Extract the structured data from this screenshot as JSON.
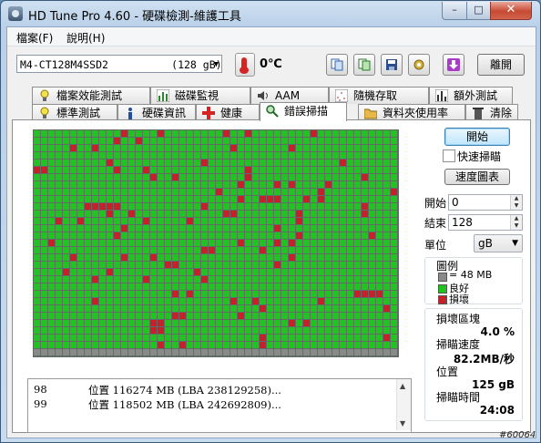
{
  "window": {
    "title": "HD Tune Pro 4.60 - 硬碟檢測-維護工具",
    "min": "–",
    "max": "□",
    "close": "✕"
  },
  "menu": {
    "file": "檔案(F)",
    "help": "說明(H)"
  },
  "toolbar": {
    "drive": "M4-CT128M4SSD2          (128 gB)",
    "temperature": "0℃",
    "exit_label": "離開"
  },
  "tabs_top": [
    {
      "label": "檔案效能測試",
      "icon": "file-benchmark-icon"
    },
    {
      "label": "磁碟監視",
      "icon": "disk-monitor-icon"
    },
    {
      "label": "AAM",
      "icon": "speaker-icon"
    },
    {
      "label": "隨機存取",
      "icon": "random-access-icon"
    },
    {
      "label": "額外測試",
      "icon": "extra-tests-icon"
    }
  ],
  "tabs_bottom": [
    {
      "label": "標準測試",
      "icon": "benchmark-bulb-icon"
    },
    {
      "label": "硬碟資訊",
      "icon": "info-icon"
    },
    {
      "label": "健康",
      "icon": "health-cross-icon"
    },
    {
      "label": "錯誤掃描",
      "icon": "magnifier-icon",
      "active": true
    },
    {
      "label": "資料夾使用率",
      "icon": "folder-icon"
    },
    {
      "label": "清除",
      "icon": "trash-icon"
    }
  ],
  "scan": {
    "start_button": "開始",
    "quick_scan_label": "快速掃瞄",
    "quick_scan_checked": false,
    "speed_map_button": "速度圖表",
    "start_label": "開始",
    "start_value": "0",
    "end_label": "結束",
    "end_value": "128",
    "unit_label": "單位",
    "unit_value": "gB",
    "legend_title": "圖例",
    "legend": [
      {
        "label": "= 48 MB",
        "color": "#8a8a8a"
      },
      {
        "label": "良好",
        "color": "#1fc41f"
      },
      {
        "label": "損壞",
        "color": "#c8202a"
      }
    ],
    "damaged_blocks_label": "損壞區塊",
    "damaged_blocks_value": "4.0 %",
    "scan_speed_label": "掃瞄速度",
    "scan_speed_value": "82.2MB/秒",
    "position_label": "位置",
    "position_value": "125 gB",
    "elapsed_label": "掃瞄時間",
    "elapsed_value": "24:08"
  },
  "map": {
    "cols": 50,
    "rows": 31,
    "good_color": "#1fc41f",
    "bad_color": "#c8202a",
    "unscanned_color": "#8a8a8a",
    "bad_blocks": [
      [
        0,
        12
      ],
      [
        0,
        17
      ],
      [
        0,
        26
      ],
      [
        0,
        29
      ],
      [
        0,
        38
      ],
      [
        1,
        11
      ],
      [
        1,
        14
      ],
      [
        2,
        5
      ],
      [
        2,
        8
      ],
      [
        2,
        27
      ],
      [
        2,
        35
      ],
      [
        4,
        10
      ],
      [
        4,
        23
      ],
      [
        4,
        42
      ],
      [
        5,
        0
      ],
      [
        5,
        1
      ],
      [
        5,
        11
      ],
      [
        5,
        15
      ],
      [
        5,
        29
      ],
      [
        6,
        16
      ],
      [
        6,
        19
      ],
      [
        6,
        29
      ],
      [
        6,
        45
      ],
      [
        7,
        28
      ],
      [
        7,
        33
      ],
      [
        7,
        35
      ],
      [
        7,
        40
      ],
      [
        8,
        25
      ],
      [
        8,
        39
      ],
      [
        8,
        49
      ],
      [
        9,
        28
      ],
      [
        9,
        31
      ],
      [
        9,
        32
      ],
      [
        9,
        33
      ],
      [
        9,
        37
      ],
      [
        9,
        39
      ],
      [
        10,
        7
      ],
      [
        10,
        8
      ],
      [
        10,
        9
      ],
      [
        10,
        10
      ],
      [
        10,
        11
      ],
      [
        10,
        23
      ],
      [
        10,
        45
      ],
      [
        11,
        10
      ],
      [
        11,
        13
      ],
      [
        11,
        26
      ],
      [
        11,
        27
      ],
      [
        11,
        36
      ],
      [
        11,
        45
      ],
      [
        12,
        3
      ],
      [
        12,
        6
      ],
      [
        12,
        15
      ],
      [
        12,
        21
      ],
      [
        12,
        36
      ],
      [
        13,
        12
      ],
      [
        13,
        33
      ],
      [
        14,
        11
      ],
      [
        14,
        36
      ],
      [
        14,
        46
      ],
      [
        15,
        2
      ],
      [
        15,
        28
      ],
      [
        15,
        33
      ],
      [
        15,
        35
      ],
      [
        16,
        23
      ],
      [
        16,
        24
      ],
      [
        16,
        31
      ],
      [
        17,
        5
      ],
      [
        17,
        12
      ],
      [
        17,
        16
      ],
      [
        17,
        35
      ],
      [
        18,
        18
      ],
      [
        18,
        19
      ],
      [
        18,
        33
      ],
      [
        19,
        4
      ],
      [
        19,
        10
      ],
      [
        19,
        22
      ],
      [
        20,
        8
      ],
      [
        20,
        15
      ],
      [
        20,
        23
      ],
      [
        22,
        19
      ],
      [
        22,
        21
      ],
      [
        22,
        44
      ],
      [
        22,
        45
      ],
      [
        22,
        46
      ],
      [
        22,
        47
      ],
      [
        23,
        8
      ],
      [
        23,
        27
      ],
      [
        23,
        30
      ],
      [
        23,
        39
      ],
      [
        24,
        31
      ],
      [
        24,
        48
      ],
      [
        25,
        19
      ],
      [
        25,
        20
      ],
      [
        25,
        28
      ],
      [
        26,
        16
      ],
      [
        26,
        17
      ],
      [
        26,
        35
      ],
      [
        26,
        37
      ],
      [
        27,
        16
      ],
      [
        27,
        17
      ],
      [
        28,
        31
      ],
      [
        28,
        48
      ],
      [
        29,
        17
      ],
      [
        29,
        20
      ],
      [
        29,
        31
      ]
    ]
  },
  "log": [
    {
      "num": "98",
      "text": "位置 116274 MB (LBA 238129258)..."
    },
    {
      "num": "99",
      "text": "位置 118502 MB (LBA 242692809)..."
    }
  ],
  "watermark": "#60064"
}
